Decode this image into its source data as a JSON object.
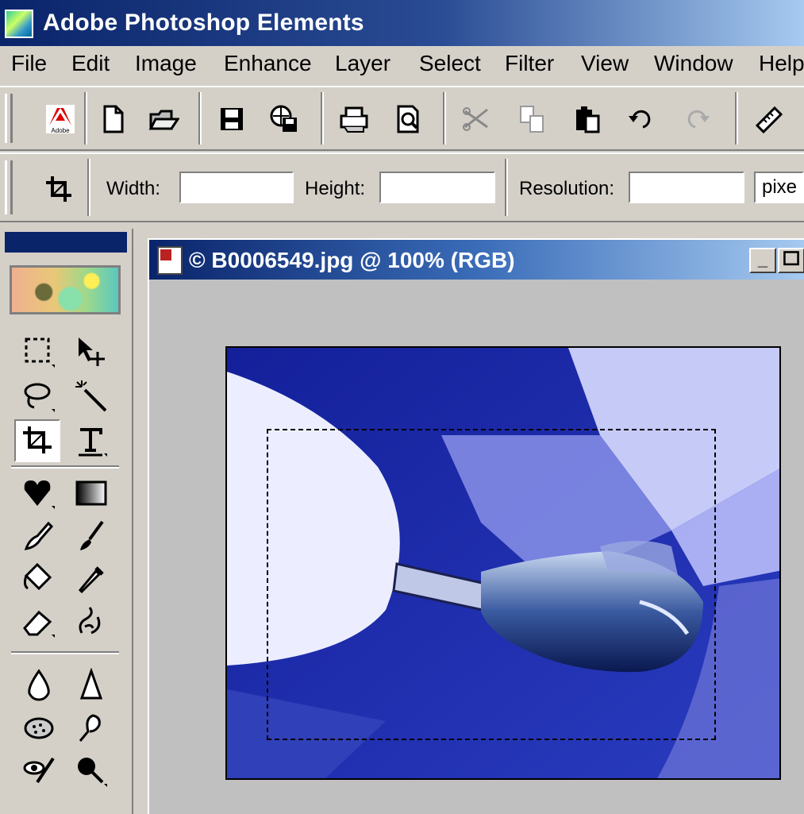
{
  "app": {
    "title": "Adobe Photoshop Elements"
  },
  "menu": [
    "File",
    "Edit",
    "Image",
    "Enhance",
    "Layer",
    "Select",
    "Filter",
    "View",
    "Window",
    "Help"
  ],
  "toolbar": {
    "icons": [
      "adobe-logo-icon",
      "new-file-icon",
      "open-folder-icon",
      "save-icon",
      "save-for-web-icon",
      "print-icon",
      "print-preview-icon",
      "cut-icon",
      "copy-icon",
      "paste-icon",
      "undo-icon",
      "redo-icon",
      "ruler-icon"
    ]
  },
  "options_bar": {
    "width_label": "Width:",
    "width_value": "",
    "height_label": "Height:",
    "height_value": "",
    "resolution_label": "Resolution:",
    "resolution_value": "",
    "units_value": "pixe"
  },
  "document": {
    "title": "© B0006549.jpg @ 100% (RGB)",
    "minimize_label": "_"
  },
  "colors": {
    "title_bar": "#0a246a",
    "chrome": "#d4d0c8",
    "canvas_blue": "#1a2a9a"
  }
}
